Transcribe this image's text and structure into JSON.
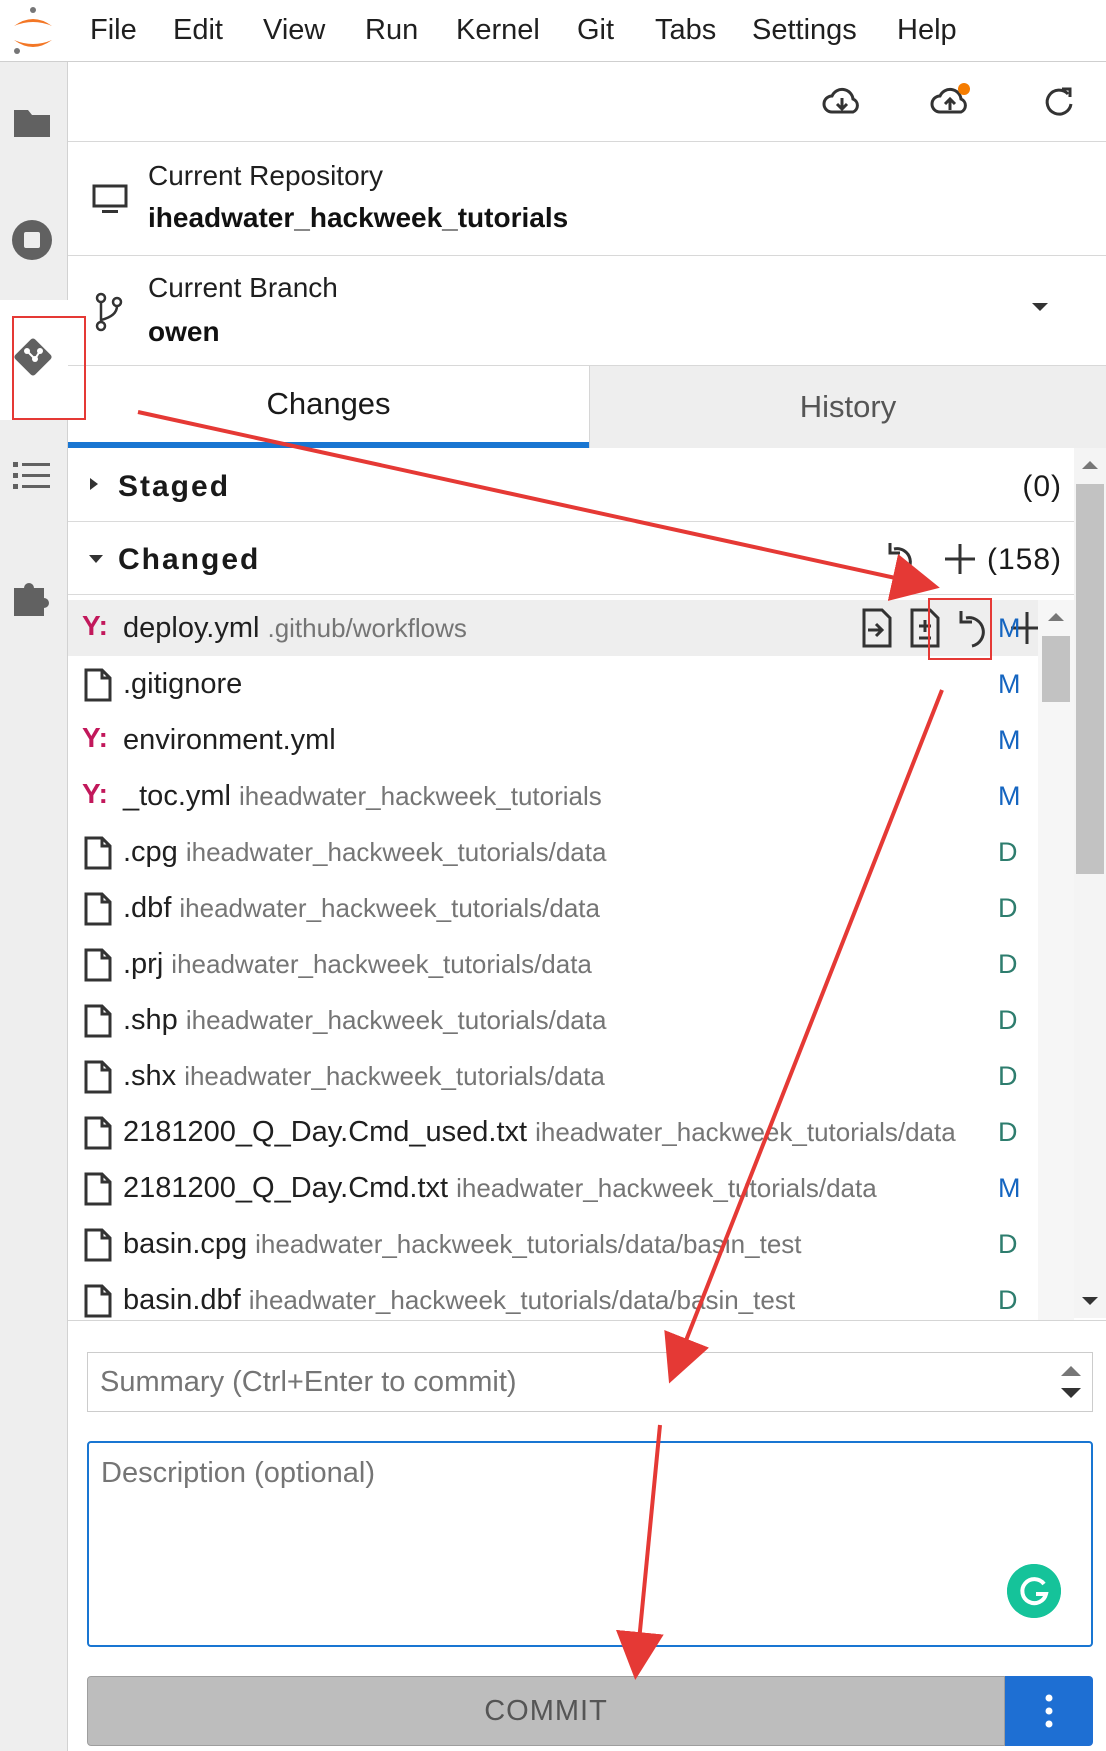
{
  "menu": [
    "File",
    "Edit",
    "View",
    "Run",
    "Kernel",
    "Git",
    "Tabs",
    "Settings",
    "Help"
  ],
  "repository": {
    "label": "Current Repository",
    "name": "iheadwater_hackweek_tutorials"
  },
  "branch": {
    "label": "Current Branch",
    "name": "owen"
  },
  "tabs": {
    "changes": "Changes",
    "history": "History"
  },
  "staged": {
    "title": "Staged",
    "count": "(0)"
  },
  "changed": {
    "title": "Changed",
    "count": "(158)"
  },
  "files": [
    {
      "name": "deploy.yml",
      "path": ".github/workflows",
      "status": "M",
      "type": "yaml"
    },
    {
      "name": ".gitignore",
      "path": "",
      "status": "M",
      "type": "file"
    },
    {
      "name": "environment.yml",
      "path": "",
      "status": "M",
      "type": "yaml"
    },
    {
      "name": "_toc.yml",
      "path": "iheadwater_hackweek_tutorials",
      "status": "M",
      "type": "yaml"
    },
    {
      "name": ".cpg",
      "path": "iheadwater_hackweek_tutorials/data",
      "status": "D",
      "type": "file"
    },
    {
      "name": ".dbf",
      "path": "iheadwater_hackweek_tutorials/data",
      "status": "D",
      "type": "file"
    },
    {
      "name": ".prj",
      "path": "iheadwater_hackweek_tutorials/data",
      "status": "D",
      "type": "file"
    },
    {
      "name": ".shp",
      "path": "iheadwater_hackweek_tutorials/data",
      "status": "D",
      "type": "file"
    },
    {
      "name": ".shx",
      "path": "iheadwater_hackweek_tutorials/data",
      "status": "D",
      "type": "file"
    },
    {
      "name": "2181200_Q_Day.Cmd_used.txt",
      "path": "iheadwater_hackweek_tutorials/data",
      "status": "D",
      "type": "file"
    },
    {
      "name": "2181200_Q_Day.Cmd.txt",
      "path": "iheadwater_hackweek_tutorials/data",
      "status": "M",
      "type": "file"
    },
    {
      "name": "basin.cpg",
      "path": "iheadwater_hackweek_tutorials/data/basin_test",
      "status": "D",
      "type": "file"
    },
    {
      "name": "basin.dbf",
      "path": "iheadwater_hackweek_tutorials/data/basin_test",
      "status": "D",
      "type": "file"
    }
  ],
  "yaml_icon_text": "Y:",
  "commit": {
    "summary_placeholder": "Summary (Ctrl+Enter to commit)",
    "description_placeholder": "Description (optional)",
    "button_label": "COMMIT"
  },
  "colors": {
    "accent": "#1976d2",
    "highlight": "#e53935",
    "status_modified": "#1565c0",
    "status_deleted": "#2e7d6e",
    "yaml_icon": "#c2185b"
  },
  "icons": [
    "jupyter-logo-icon",
    "folder-icon",
    "stop-circle-icon",
    "git-icon",
    "list-icon",
    "puzzle-icon",
    "cloud-download-icon",
    "cloud-upload-icon",
    "refresh-icon",
    "monitor-icon",
    "branch-icon",
    "caret-down-icon",
    "discard-icon",
    "add-icon",
    "open-file-icon",
    "diff-icon",
    "grammarly-icon",
    "more-vertical-icon"
  ]
}
